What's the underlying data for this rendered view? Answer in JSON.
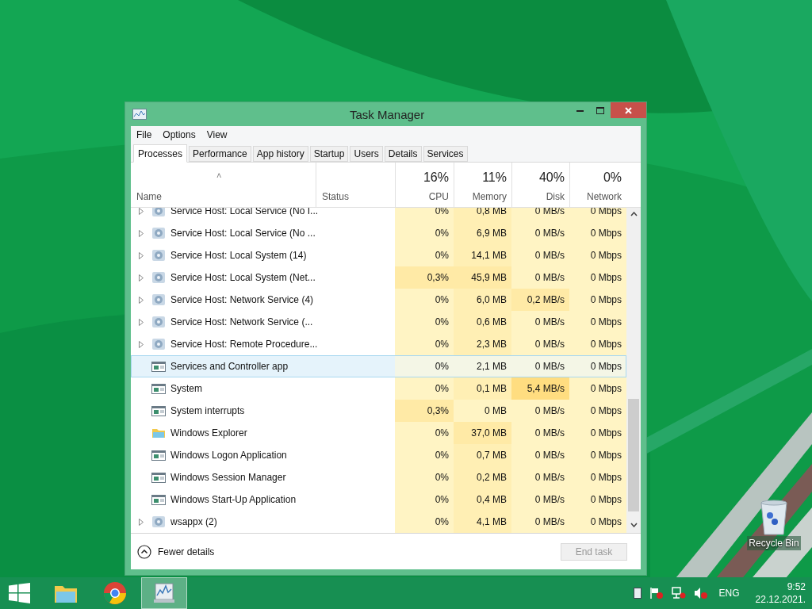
{
  "desktop": {
    "icons": [
      {
        "label": "Recycle Bin"
      }
    ]
  },
  "window": {
    "title": "Task Manager"
  },
  "menu": [
    "File",
    "Options",
    "View"
  ],
  "tabs": [
    {
      "label": "Processes",
      "selected": true
    },
    {
      "label": "Performance",
      "selected": false
    },
    {
      "label": "App history",
      "selected": false
    },
    {
      "label": "Startup",
      "selected": false
    },
    {
      "label": "Users",
      "selected": false
    },
    {
      "label": "Details",
      "selected": false
    },
    {
      "label": "Services",
      "selected": false
    }
  ],
  "resource_totals": [
    "16%",
    "11%",
    "40%",
    "0%"
  ],
  "table": {
    "columns": [
      {
        "label": "Name"
      },
      {
        "label": "Status"
      },
      {
        "label": "CPU"
      },
      {
        "label": "Memory"
      },
      {
        "label": "Disk"
      },
      {
        "label": "Network"
      }
    ],
    "sort_mark": "˄",
    "rows": [
      {
        "name": "Service Host: Local Service (No I...",
        "kind": "gear",
        "expandable": true,
        "selected": false,
        "usage": [
          {
            "text": "0%",
            "color": "#fff4c4"
          },
          {
            "text": "0,8 MB",
            "color": "#ffefb4"
          },
          {
            "text": "0 MB/s",
            "color": "#fff4c4"
          },
          {
            "text": "0 Mbps",
            "color": "#fff4c4"
          }
        ]
      },
      {
        "name": "Service Host: Local Service (No ...",
        "kind": "gear",
        "expandable": true,
        "selected": false,
        "usage": [
          {
            "text": "0%",
            "color": "#fff4c4"
          },
          {
            "text": "6,9 MB",
            "color": "#ffefb4"
          },
          {
            "text": "0 MB/s",
            "color": "#fff4c4"
          },
          {
            "text": "0 Mbps",
            "color": "#fff4c4"
          }
        ]
      },
      {
        "name": "Service Host: Local System (14)",
        "kind": "gear",
        "expandable": true,
        "selected": false,
        "usage": [
          {
            "text": "0%",
            "color": "#fff4c4"
          },
          {
            "text": "14,1 MB",
            "color": "#ffefb4"
          },
          {
            "text": "0 MB/s",
            "color": "#fff4c4"
          },
          {
            "text": "0 Mbps",
            "color": "#fff4c4"
          }
        ]
      },
      {
        "name": "Service Host: Local System (Net...",
        "kind": "gear",
        "expandable": true,
        "selected": false,
        "usage": [
          {
            "text": "0,3%",
            "color": "#ffeaa6"
          },
          {
            "text": "45,9 MB",
            "color": "#ffeaa6"
          },
          {
            "text": "0 MB/s",
            "color": "#fff4c4"
          },
          {
            "text": "0 Mbps",
            "color": "#fff4c4"
          }
        ]
      },
      {
        "name": "Service Host: Network Service (4)",
        "kind": "gear",
        "expandable": true,
        "selected": false,
        "usage": [
          {
            "text": "0%",
            "color": "#fff4c4"
          },
          {
            "text": "6,0 MB",
            "color": "#ffefb4"
          },
          {
            "text": "0,2 MB/s",
            "color": "#ffeaa6"
          },
          {
            "text": "0 Mbps",
            "color": "#fff4c4"
          }
        ]
      },
      {
        "name": "Service Host: Network Service (...",
        "kind": "gear",
        "expandable": true,
        "selected": false,
        "usage": [
          {
            "text": "0%",
            "color": "#fff4c4"
          },
          {
            "text": "0,6 MB",
            "color": "#ffefb4"
          },
          {
            "text": "0 MB/s",
            "color": "#fff4c4"
          },
          {
            "text": "0 Mbps",
            "color": "#fff4c4"
          }
        ]
      },
      {
        "name": "Service Host: Remote Procedure...",
        "kind": "gear",
        "expandable": true,
        "selected": false,
        "usage": [
          {
            "text": "0%",
            "color": "#fff4c4"
          },
          {
            "text": "2,3 MB",
            "color": "#ffefb4"
          },
          {
            "text": "0 MB/s",
            "color": "#fff4c4"
          },
          {
            "text": "0 Mbps",
            "color": "#fff4c4"
          }
        ]
      },
      {
        "name": "Services and Controller app",
        "kind": "window",
        "expandable": false,
        "selected": true,
        "usage": [
          {
            "text": "0%",
            "color": "#f4f6e6"
          },
          {
            "text": "2,1 MB",
            "color": "#f4f6e6"
          },
          {
            "text": "0 MB/s",
            "color": "#f4f6e6"
          },
          {
            "text": "0 Mbps",
            "color": "#f4f6e6"
          }
        ]
      },
      {
        "name": "System",
        "kind": "window",
        "expandable": false,
        "selected": false,
        "usage": [
          {
            "text": "0%",
            "color": "#fff4c4"
          },
          {
            "text": "0,1 MB",
            "color": "#ffefb4"
          },
          {
            "text": "5,4 MB/s",
            "color": "#ffdd80"
          },
          {
            "text": "0 Mbps",
            "color": "#fff4c4"
          }
        ]
      },
      {
        "name": "System interrupts",
        "kind": "window",
        "expandable": false,
        "selected": false,
        "usage": [
          {
            "text": "0,3%",
            "color": "#ffeaa6"
          },
          {
            "text": "0 MB",
            "color": "#fff4c4"
          },
          {
            "text": "0 MB/s",
            "color": "#fff4c4"
          },
          {
            "text": "0 Mbps",
            "color": "#fff4c4"
          }
        ]
      },
      {
        "name": "Windows Explorer",
        "kind": "folder",
        "expandable": false,
        "selected": false,
        "usage": [
          {
            "text": "0%",
            "color": "#fff4c4"
          },
          {
            "text": "37,0 MB",
            "color": "#ffeaa6"
          },
          {
            "text": "0 MB/s",
            "color": "#fff4c4"
          },
          {
            "text": "0 Mbps",
            "color": "#fff4c4"
          }
        ]
      },
      {
        "name": "Windows Logon Application",
        "kind": "window",
        "expandable": false,
        "selected": false,
        "usage": [
          {
            "text": "0%",
            "color": "#fff4c4"
          },
          {
            "text": "0,7 MB",
            "color": "#ffefb4"
          },
          {
            "text": "0 MB/s",
            "color": "#fff4c4"
          },
          {
            "text": "0 Mbps",
            "color": "#fff4c4"
          }
        ]
      },
      {
        "name": "Windows Session Manager",
        "kind": "window",
        "expandable": false,
        "selected": false,
        "usage": [
          {
            "text": "0%",
            "color": "#fff4c4"
          },
          {
            "text": "0,2 MB",
            "color": "#ffefb4"
          },
          {
            "text": "0 MB/s",
            "color": "#fff4c4"
          },
          {
            "text": "0 Mbps",
            "color": "#fff4c4"
          }
        ]
      },
      {
        "name": "Windows Start-Up Application",
        "kind": "window",
        "expandable": false,
        "selected": false,
        "usage": [
          {
            "text": "0%",
            "color": "#fff4c4"
          },
          {
            "text": "0,4 MB",
            "color": "#ffefb4"
          },
          {
            "text": "0 MB/s",
            "color": "#fff4c4"
          },
          {
            "text": "0 Mbps",
            "color": "#fff4c4"
          }
        ]
      },
      {
        "name": "wsappx (2)",
        "kind": "gear",
        "expandable": true,
        "selected": false,
        "usage": [
          {
            "text": "0%",
            "color": "#fff4c4"
          },
          {
            "text": "4,1 MB",
            "color": "#ffefb4"
          },
          {
            "text": "0 MB/s",
            "color": "#fff4c4"
          },
          {
            "text": "0 Mbps",
            "color": "#fff4c4"
          }
        ]
      }
    ]
  },
  "footer": {
    "details_toggle": "Fewer details",
    "end_task": {
      "label": "End task",
      "disabled": true
    }
  },
  "taskbar": {
    "apps": [
      {
        "kind": "folder",
        "active": false
      },
      {
        "kind": "browser",
        "active": false
      },
      {
        "kind": "taskmgr",
        "active": true
      }
    ],
    "language": "ENG",
    "time": "9:52",
    "date": "22.12.2021."
  }
}
